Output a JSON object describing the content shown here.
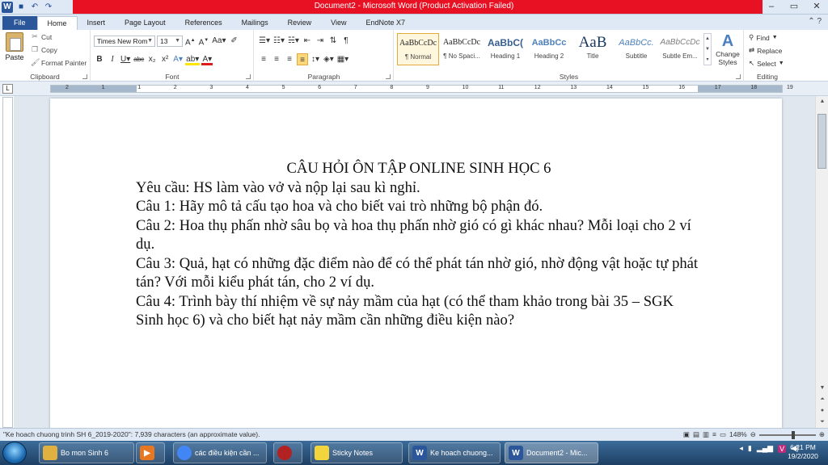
{
  "window": {
    "title": "Document2 - Microsoft Word (Product Activation Failed)",
    "controls": [
      "–",
      "▭",
      "✕"
    ]
  },
  "quick_access": [
    "W",
    "💾",
    "↶",
    "↷"
  ],
  "tabs": [
    {
      "label": "File"
    },
    {
      "label": "Home"
    },
    {
      "label": "Insert"
    },
    {
      "label": "Page Layout"
    },
    {
      "label": "References"
    },
    {
      "label": "Mailings"
    },
    {
      "label": "Review"
    },
    {
      "label": "View"
    },
    {
      "label": "EndNote X7"
    }
  ],
  "ribbon": {
    "clipboard": {
      "label": "Clipboard",
      "paste": "Paste",
      "cut": "Cut",
      "copy": "Copy",
      "format_painter": "Format Painter"
    },
    "font": {
      "label": "Font",
      "family": "Times New Rom",
      "size": "13"
    },
    "paragraph": {
      "label": "Paragraph"
    },
    "styles": {
      "label": "Styles",
      "items": [
        {
          "sample": "AaBbCcDc",
          "name": "¶ Normal"
        },
        {
          "sample": "AaBbCcDc",
          "name": "¶ No Spaci..."
        },
        {
          "sample": "AaBbC(",
          "name": "Heading 1"
        },
        {
          "sample": "AaBbCc",
          "name": "Heading 2"
        },
        {
          "sample": "AaB",
          "name": "Title"
        },
        {
          "sample": "AaBbCc.",
          "name": "Subtitle"
        },
        {
          "sample": "AaBbCcDc",
          "name": "Subtle Em..."
        }
      ],
      "change_styles": "Change Styles"
    },
    "editing": {
      "label": "Editing",
      "find": "Find",
      "replace": "Replace",
      "select": "Select"
    }
  },
  "ruler_numbers": [
    "2",
    "1",
    "1",
    "2",
    "3",
    "4",
    "5",
    "6",
    "7",
    "8",
    "9",
    "10",
    "11",
    "12",
    "13",
    "14",
    "15",
    "16",
    "17",
    "18",
    "19"
  ],
  "document": {
    "title": "CÂU HỎI ÔN TẬP ONLINE SINH HỌC 6",
    "paragraphs": [
      "Yêu cầu: HS làm vào vở và nộp lại sau kì nghỉ.",
      "Câu 1: Hãy mô tả cấu tạo hoa và cho biết vai trò những bộ phận đó.",
      "Câu 2: Hoa thụ phấn nhờ sâu bọ và hoa thụ phấn nhờ gió có gì khác nhau? Mỗi loại cho 2 ví dụ.",
      "Câu 3: Quả, hạt có những đặc điểm nào để có thể phát tán nhờ gió, nhờ động vật hoặc tự phát tán? Với mỗi kiểu phát tán, cho 2 ví dụ.",
      "Câu 4: Trình bày thí nhiệm về sự nảy mầm của hạt (có thể tham khảo trong bài 35 – SGK Sinh học 6) và cho biết hạt nảy mầm cần những điều kiện nào?"
    ]
  },
  "status_bar": {
    "text": "\"Ke hoach chuong trinh SH 6_2019-2020\": 7,939 characters (an approximate value).",
    "zoom": "148%"
  },
  "taskbar": {
    "items": [
      {
        "label": "Bo mon Sinh 6",
        "color": "#e0b040"
      },
      {
        "label": "",
        "color": "#e87722"
      },
      {
        "label": "các điều kiện cần ...",
        "color": "#4285f4"
      },
      {
        "label": "",
        "color": "#b22222"
      },
      {
        "label": "Sticky Notes",
        "color": "#f2d43c"
      },
      {
        "label": "Ke hoach chuong...",
        "color": "#2b579a"
      },
      {
        "label": "Document2 - Mic...",
        "color": "#2b579a"
      }
    ],
    "time": "6:21 PM",
    "date": "19/2/2020"
  }
}
